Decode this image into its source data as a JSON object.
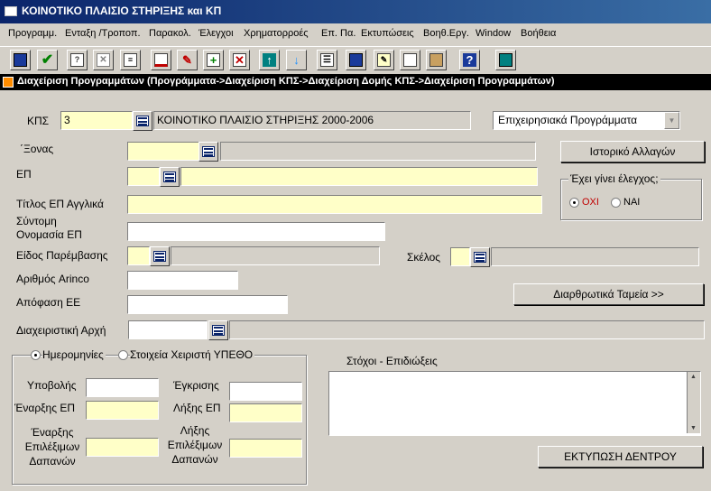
{
  "window": {
    "title": "ΚΟΙΝΟΤΙΚΟ ΠΛΑΙΣΙΟ ΣΤΗΡΙΞΗΣ και ΚΠ"
  },
  "menu": [
    "Προγραμμ.",
    "Ενταξη /Τροποπ.",
    "Παρακολ.",
    "Έλεγχοι",
    "Χρηματορροές",
    "Επ. Πα.",
    "Εκτυπώσεις",
    "Βοηθ.Εργ.",
    "Window",
    "Βοήθεια"
  ],
  "inner_window": {
    "title": "Διαχείριση Προγραμμάτων (Προγράμματα->Διαχείριση ΚΠΣ->Διαχείριση Δομής ΚΠΣ->Διαχείριση Προγραμμάτων)"
  },
  "kps": {
    "label": "ΚΠΣ",
    "code": "3",
    "description": "ΚΟΙΝΟΤΙΚΟ ΠΛΑΙΣΙΟ ΣΤΗΡΙΞΗΣ 2000-2006",
    "type_select": "Επιχειρησιακά Προγράμματα"
  },
  "form": {
    "axonas_label": "΄Ξονας",
    "ep_label": "ΕΠ",
    "title_en_label": "Τίτλος ΕΠ Αγγλικά",
    "short_name_label": "Σύντομη Ονομασία ΕΠ",
    "intervention_type_label": "Είδος Παρέμβασης",
    "skelos_label": "Σκέλος",
    "arinco_label": "Αριθμός Arinco",
    "ee_decision_label": "Απόφαση ΕΕ",
    "managing_authority_label": "Διαχειριστική Αρχή",
    "goals_label": "Στόχοι - Επιδιώξεις"
  },
  "buttons": {
    "history": "Ιστορικό Αλλαγών",
    "structural_funds": "Διαρθρωτικά Ταμεία >>",
    "print_tree": "ΕΚΤΥΠΩΣΗ ΔΕΝΤΡΟΥ"
  },
  "check_group": {
    "title": "Έχει γίνει έλεγχος;",
    "no": "ΟΧΙ",
    "yes": "ΝΑΙ",
    "selected": "no"
  },
  "dates_tabs": {
    "dates": "Ημερομηνίες",
    "ypetho": "Στοιχεία Χειριστή ΥΠΕΘΟ",
    "selected": "dates"
  },
  "dates": {
    "submission": "Υποβολής",
    "approval": "Έγκρισης",
    "ep_start": "Έναρξης ΕΠ",
    "ep_end": "Λήξης ΕΠ",
    "eligible_start": "Έναρξης Επιλέξιμων Δαπανών",
    "eligible_end": "Λήξης Επιλέξιμων Δαπανών"
  },
  "colors": {
    "required": "#ffffc8",
    "title_bar": "#0a246a",
    "no_text": "#c00000"
  }
}
